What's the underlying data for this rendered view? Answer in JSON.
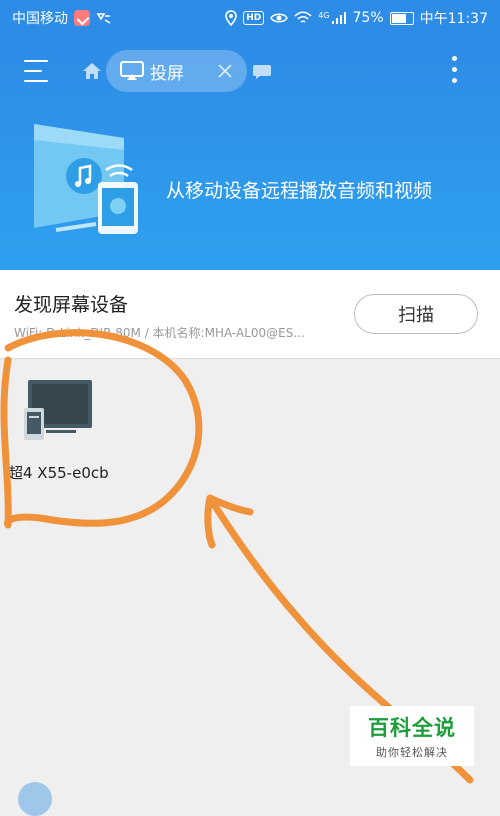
{
  "status_bar": {
    "carrier": "中国移动",
    "signal_label": "4G",
    "battery_percent": "75%",
    "battery_level": 0.75,
    "time": "中午11:37",
    "hd_label": "HD"
  },
  "header": {
    "tab_label": "投屏",
    "banner_text": "从移动设备远程播放音频和视频"
  },
  "device_panel": {
    "title": "发现屏幕设备",
    "subtitle": "WiFi: D-Link_DIR-80M / 本机名称:MHA-AL00@ES...",
    "scan_label": "扫描"
  },
  "devices": [
    {
      "name": "超4 X55-e0cb"
    }
  ],
  "watermark": {
    "title": "百科全说",
    "subtitle": "助你轻松解决"
  },
  "colors": {
    "header_blue": "#2e8ce6",
    "annotation_orange": "#f0923a",
    "watermark_green": "#1c9f3b"
  },
  "icons": [
    "menu-icon",
    "home-icon",
    "cast-icon",
    "close-icon",
    "chat-icon",
    "more-vertical-icon",
    "tv-phone-icon"
  ]
}
